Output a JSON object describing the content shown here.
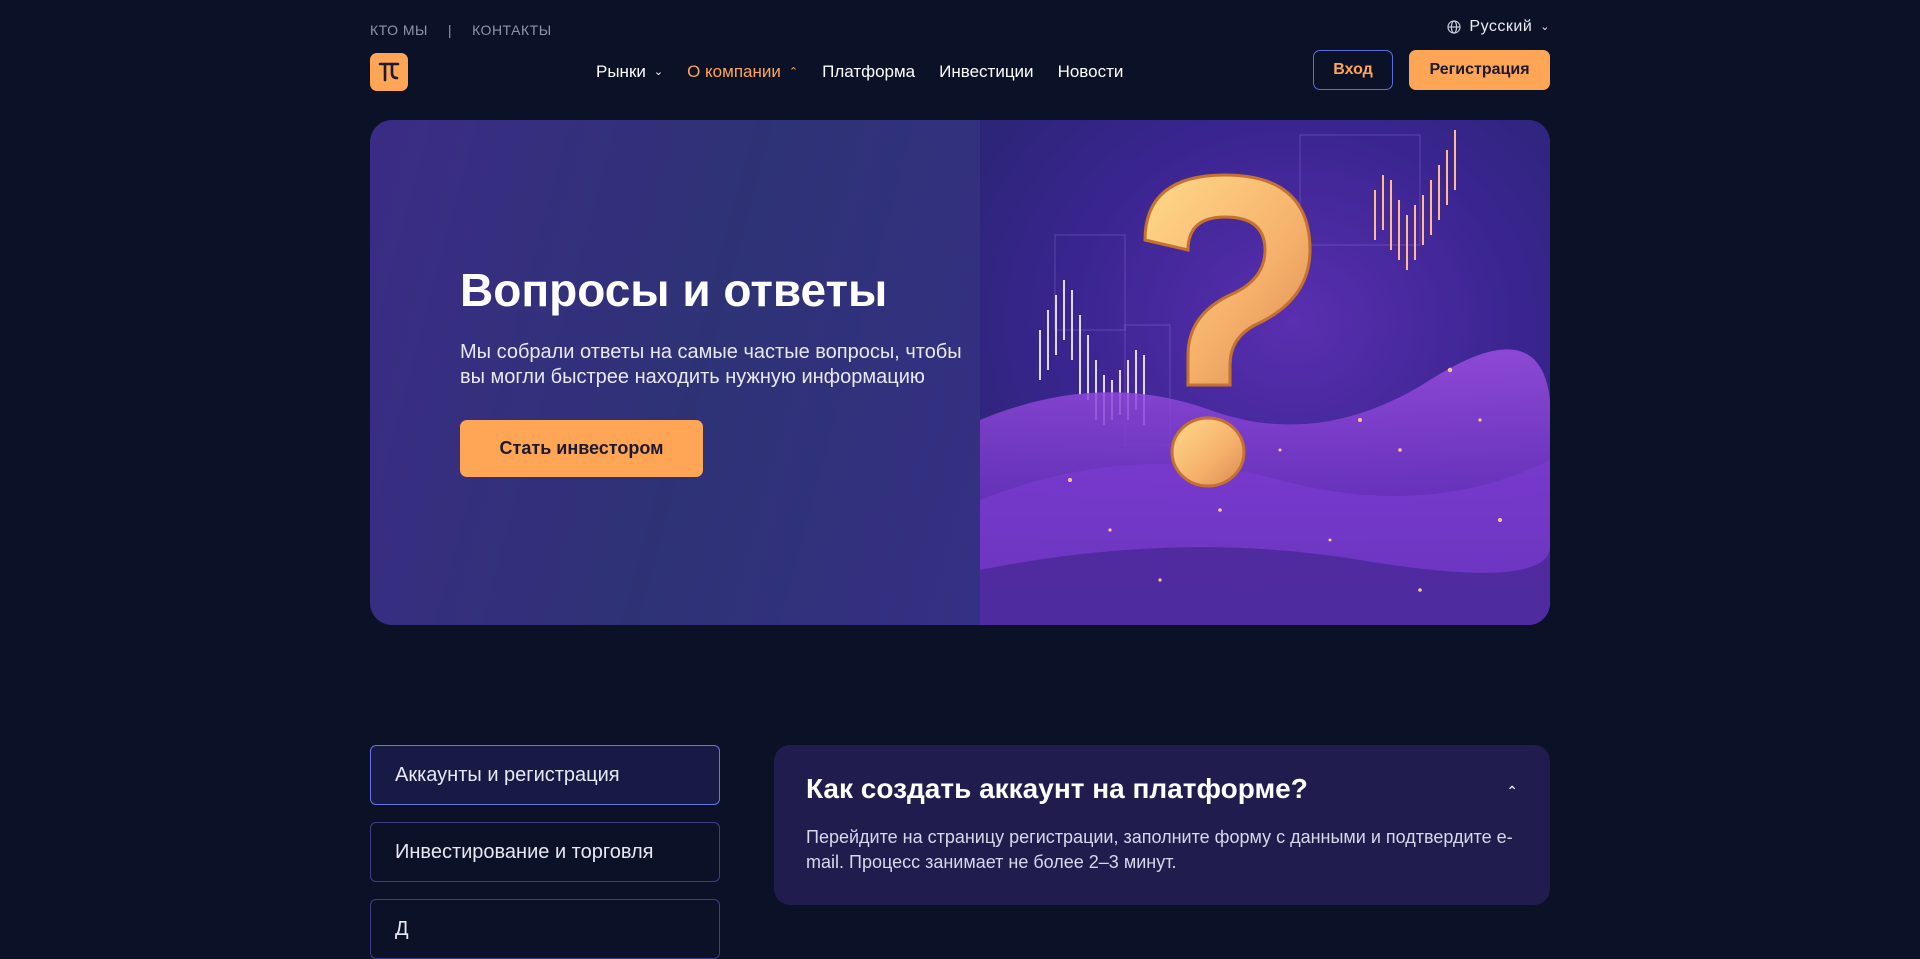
{
  "topbar": {
    "links": [
      "КТО МЫ",
      "КОНТАКТЫ"
    ],
    "separator": "|",
    "language": "Русский"
  },
  "nav": {
    "items": [
      {
        "label": "Рынки",
        "has_dropdown": true,
        "expanded": false
      },
      {
        "label": "О компании",
        "has_dropdown": true,
        "expanded": true
      },
      {
        "label": "Платформа"
      },
      {
        "label": "Инвестиции"
      },
      {
        "label": "Новости"
      }
    ],
    "chevron_down": "⌄",
    "chevron_up": "⌃",
    "login_label": "Вход",
    "register_label": "Регистрация"
  },
  "hero": {
    "title": "Вопросы и ответы",
    "subtitle": "Мы собрали ответы на самые частые вопросы, чтобы вы могли быстрее находить нужную информацию",
    "cta_label": "Стать инвестором"
  },
  "faq": {
    "categories": [
      {
        "label": "Аккаунты и регистрация",
        "active": true
      },
      {
        "label": "Инвестирование и торговля",
        "active": false
      },
      {
        "label": "Д",
        "active": false
      }
    ],
    "question": "Как создать аккаунт на платформе?",
    "answer": "Перейдите на страницу регистрации, заполните форму с данными и подтвердите e-mail. Процесс занимает не более 2–3 минут."
  },
  "colors": {
    "background": "#0b1127",
    "accent": "#ffa556",
    "hero_bg": "#33308a",
    "card_bg": "#201c4d",
    "border": "#5a6ee0"
  },
  "icons": [
    "globe-icon",
    "chevron-down-icon",
    "chevron-up-icon",
    "logo-icon",
    "question-mark-illustration"
  ]
}
